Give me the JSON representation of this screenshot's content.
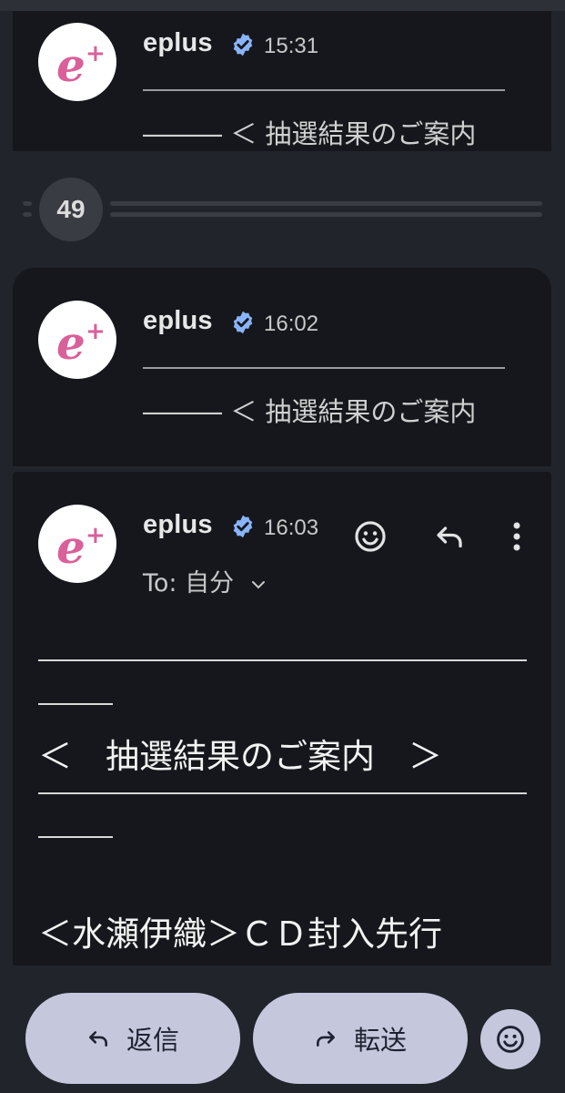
{
  "messages": [
    {
      "sender": "eplus",
      "time": "15:31",
      "snippet": "――― ＜ 抽選結果のご案内"
    },
    {
      "sender": "eplus",
      "time": "16:02",
      "snippet": "――― ＜ 抽選結果のご案内"
    }
  ],
  "collapsed_count": "49",
  "open_message": {
    "sender": "eplus",
    "time": "16:03",
    "to_label": "To: 自分",
    "body_heading": "＜　抽選結果のご案内　＞",
    "body_line": "＜水瀬伊織＞ＣＤ封入先行"
  },
  "actions": {
    "reply_label": "返信",
    "forward_label": "転送"
  },
  "colors": {
    "background": "#22242b",
    "card": "#16171c",
    "avatar_logo": "#d9609a",
    "verified_badge": "#8ab4f8",
    "bottom_button": "#c5c8dd"
  },
  "icons": [
    "avatar-logo",
    "verified-icon",
    "emoji-icon",
    "reply-icon",
    "more-vert-icon",
    "chevron-down-icon",
    "forward-icon"
  ]
}
